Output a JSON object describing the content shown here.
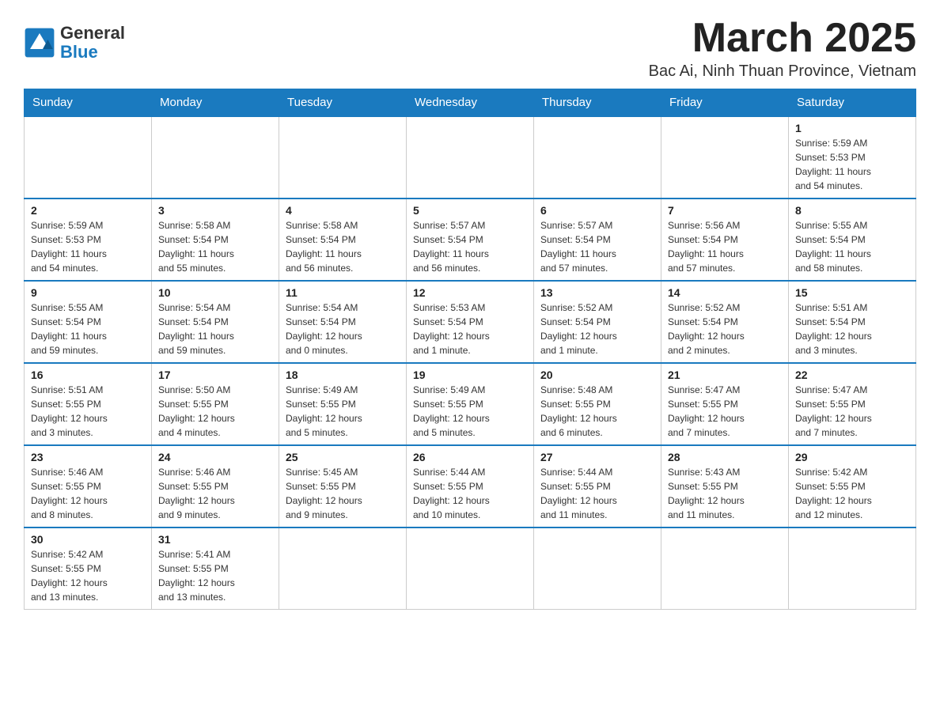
{
  "header": {
    "logo_general": "General",
    "logo_blue": "Blue",
    "month_title": "March 2025",
    "location": "Bac Ai, Ninh Thuan Province, Vietnam"
  },
  "days_of_week": [
    "Sunday",
    "Monday",
    "Tuesday",
    "Wednesday",
    "Thursday",
    "Friday",
    "Saturday"
  ],
  "weeks": [
    [
      {
        "day": "",
        "info": ""
      },
      {
        "day": "",
        "info": ""
      },
      {
        "day": "",
        "info": ""
      },
      {
        "day": "",
        "info": ""
      },
      {
        "day": "",
        "info": ""
      },
      {
        "day": "",
        "info": ""
      },
      {
        "day": "1",
        "info": "Sunrise: 5:59 AM\nSunset: 5:53 PM\nDaylight: 11 hours\nand 54 minutes."
      }
    ],
    [
      {
        "day": "2",
        "info": "Sunrise: 5:59 AM\nSunset: 5:53 PM\nDaylight: 11 hours\nand 54 minutes."
      },
      {
        "day": "3",
        "info": "Sunrise: 5:58 AM\nSunset: 5:54 PM\nDaylight: 11 hours\nand 55 minutes."
      },
      {
        "day": "4",
        "info": "Sunrise: 5:58 AM\nSunset: 5:54 PM\nDaylight: 11 hours\nand 56 minutes."
      },
      {
        "day": "5",
        "info": "Sunrise: 5:57 AM\nSunset: 5:54 PM\nDaylight: 11 hours\nand 56 minutes."
      },
      {
        "day": "6",
        "info": "Sunrise: 5:57 AM\nSunset: 5:54 PM\nDaylight: 11 hours\nand 57 minutes."
      },
      {
        "day": "7",
        "info": "Sunrise: 5:56 AM\nSunset: 5:54 PM\nDaylight: 11 hours\nand 57 minutes."
      },
      {
        "day": "8",
        "info": "Sunrise: 5:55 AM\nSunset: 5:54 PM\nDaylight: 11 hours\nand 58 minutes."
      }
    ],
    [
      {
        "day": "9",
        "info": "Sunrise: 5:55 AM\nSunset: 5:54 PM\nDaylight: 11 hours\nand 59 minutes."
      },
      {
        "day": "10",
        "info": "Sunrise: 5:54 AM\nSunset: 5:54 PM\nDaylight: 11 hours\nand 59 minutes."
      },
      {
        "day": "11",
        "info": "Sunrise: 5:54 AM\nSunset: 5:54 PM\nDaylight: 12 hours\nand 0 minutes."
      },
      {
        "day": "12",
        "info": "Sunrise: 5:53 AM\nSunset: 5:54 PM\nDaylight: 12 hours\nand 1 minute."
      },
      {
        "day": "13",
        "info": "Sunrise: 5:52 AM\nSunset: 5:54 PM\nDaylight: 12 hours\nand 1 minute."
      },
      {
        "day": "14",
        "info": "Sunrise: 5:52 AM\nSunset: 5:54 PM\nDaylight: 12 hours\nand 2 minutes."
      },
      {
        "day": "15",
        "info": "Sunrise: 5:51 AM\nSunset: 5:54 PM\nDaylight: 12 hours\nand 3 minutes."
      }
    ],
    [
      {
        "day": "16",
        "info": "Sunrise: 5:51 AM\nSunset: 5:55 PM\nDaylight: 12 hours\nand 3 minutes."
      },
      {
        "day": "17",
        "info": "Sunrise: 5:50 AM\nSunset: 5:55 PM\nDaylight: 12 hours\nand 4 minutes."
      },
      {
        "day": "18",
        "info": "Sunrise: 5:49 AM\nSunset: 5:55 PM\nDaylight: 12 hours\nand 5 minutes."
      },
      {
        "day": "19",
        "info": "Sunrise: 5:49 AM\nSunset: 5:55 PM\nDaylight: 12 hours\nand 5 minutes."
      },
      {
        "day": "20",
        "info": "Sunrise: 5:48 AM\nSunset: 5:55 PM\nDaylight: 12 hours\nand 6 minutes."
      },
      {
        "day": "21",
        "info": "Sunrise: 5:47 AM\nSunset: 5:55 PM\nDaylight: 12 hours\nand 7 minutes."
      },
      {
        "day": "22",
        "info": "Sunrise: 5:47 AM\nSunset: 5:55 PM\nDaylight: 12 hours\nand 7 minutes."
      }
    ],
    [
      {
        "day": "23",
        "info": "Sunrise: 5:46 AM\nSunset: 5:55 PM\nDaylight: 12 hours\nand 8 minutes."
      },
      {
        "day": "24",
        "info": "Sunrise: 5:46 AM\nSunset: 5:55 PM\nDaylight: 12 hours\nand 9 minutes."
      },
      {
        "day": "25",
        "info": "Sunrise: 5:45 AM\nSunset: 5:55 PM\nDaylight: 12 hours\nand 9 minutes."
      },
      {
        "day": "26",
        "info": "Sunrise: 5:44 AM\nSunset: 5:55 PM\nDaylight: 12 hours\nand 10 minutes."
      },
      {
        "day": "27",
        "info": "Sunrise: 5:44 AM\nSunset: 5:55 PM\nDaylight: 12 hours\nand 11 minutes."
      },
      {
        "day": "28",
        "info": "Sunrise: 5:43 AM\nSunset: 5:55 PM\nDaylight: 12 hours\nand 11 minutes."
      },
      {
        "day": "29",
        "info": "Sunrise: 5:42 AM\nSunset: 5:55 PM\nDaylight: 12 hours\nand 12 minutes."
      }
    ],
    [
      {
        "day": "30",
        "info": "Sunrise: 5:42 AM\nSunset: 5:55 PM\nDaylight: 12 hours\nand 13 minutes."
      },
      {
        "day": "31",
        "info": "Sunrise: 5:41 AM\nSunset: 5:55 PM\nDaylight: 12 hours\nand 13 minutes."
      },
      {
        "day": "",
        "info": ""
      },
      {
        "day": "",
        "info": ""
      },
      {
        "day": "",
        "info": ""
      },
      {
        "day": "",
        "info": ""
      },
      {
        "day": "",
        "info": ""
      }
    ]
  ]
}
